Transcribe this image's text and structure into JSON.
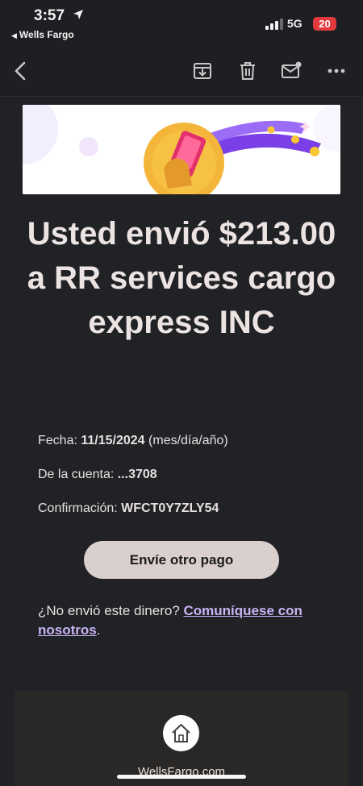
{
  "status_bar": {
    "time": "3:57",
    "back_app": "Wells Fargo",
    "network": "5G",
    "battery": "20"
  },
  "toolbar": {
    "icons": [
      "back-arrow-icon",
      "archive-icon",
      "trash-icon",
      "mark-unread-icon",
      "more-icon"
    ]
  },
  "email": {
    "headline": "Usted envió $213.00 a RR services cargo express INC",
    "details": {
      "date_label": "Fecha:",
      "date_value": "11/15/2024",
      "date_format": "(mes/día/año)",
      "account_label": "De la cuenta:",
      "account_value": "...3708",
      "confirmation_label": "Confirmación:",
      "confirmation_value": "WFCT0Y7ZLY54"
    },
    "primary_button": "Envíe otro pago",
    "help_text": "¿No envió este dinero?",
    "help_link": "Comuníquese con nosotros",
    "help_end": "."
  },
  "footer": {
    "site": "WellsFargo.com"
  },
  "colors": {
    "background": "#202124",
    "button": "#d9cfcc",
    "link": "#c7b3f2",
    "banner_purple": "#8a46f0",
    "banner_gold": "#f6b92c",
    "battery": "#e0393e"
  }
}
